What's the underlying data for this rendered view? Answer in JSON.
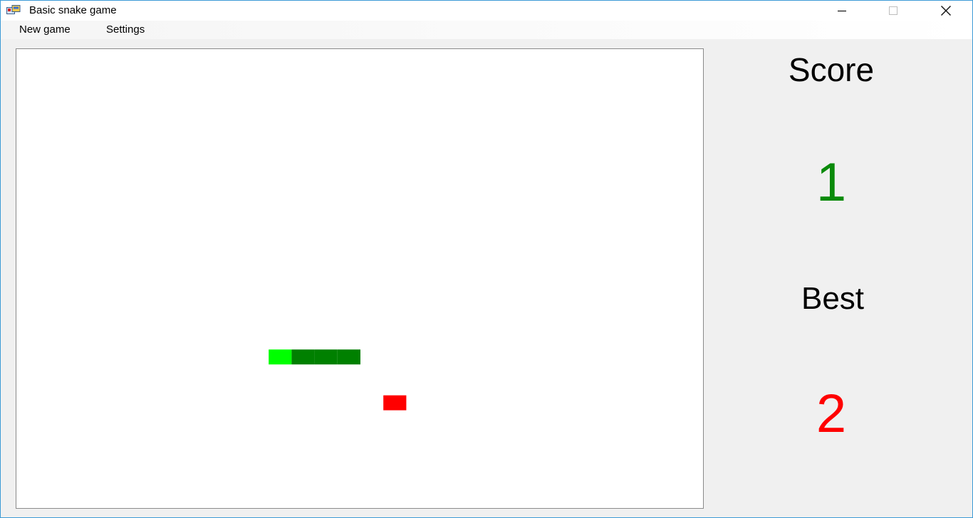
{
  "window": {
    "title": "Basic snake game",
    "app_icon": "app-window-icon"
  },
  "menu": {
    "new_game_label": "New game",
    "settings_label": "Settings"
  },
  "scoreboard": {
    "score_label": "Score",
    "score_value": "1",
    "best_label": "Best",
    "best_value": "2",
    "score_color": "#0a8a0a",
    "best_color": "#ff0000"
  },
  "game": {
    "grid_columns": 30,
    "grid_rows": 20,
    "snake": [
      {
        "col": 11,
        "row": 13,
        "part": "head"
      },
      {
        "col": 12,
        "row": 13,
        "part": "body"
      },
      {
        "col": 13,
        "row": 13,
        "part": "body"
      },
      {
        "col": 14,
        "row": 13,
        "part": "body"
      }
    ],
    "food": {
      "col": 16,
      "row": 15
    },
    "colors": {
      "head": "#00ff00",
      "body": "#008000",
      "food": "#ff0000",
      "background": "#ffffff"
    }
  }
}
